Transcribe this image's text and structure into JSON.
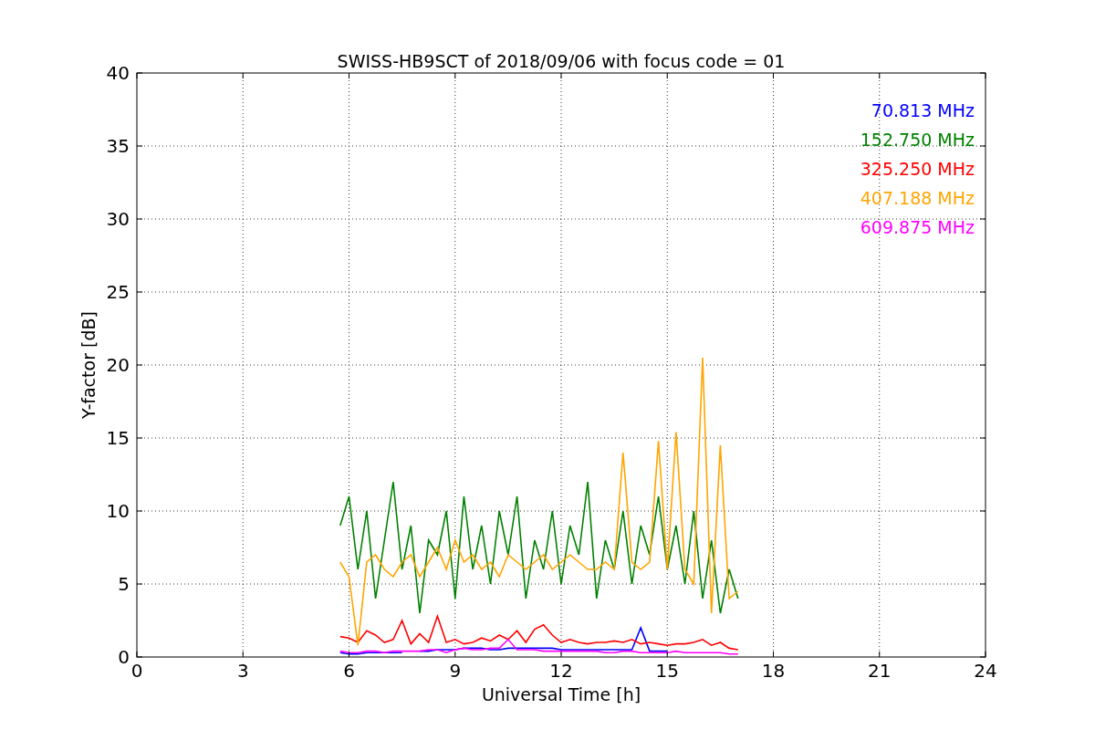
{
  "chart_data": {
    "type": "line",
    "title": "SWISS-HB9SCT of 2018/09/06 with focus code = 01",
    "xlabel": "Universal Time [h]",
    "ylabel": "Y-factor [dB]",
    "grid": true,
    "xlim": [
      0,
      24
    ],
    "ylim": [
      0,
      40
    ],
    "xticks": [
      0,
      3,
      6,
      9,
      12,
      15,
      18,
      21,
      24
    ],
    "yticks": [
      0,
      5,
      10,
      15,
      20,
      25,
      30,
      35,
      40
    ],
    "x": [
      5.75,
      6,
      6.25,
      6.5,
      6.75,
      7,
      7.25,
      7.5,
      7.75,
      8,
      8.25,
      8.5,
      8.75,
      9,
      9.25,
      9.5,
      9.75,
      10,
      10.25,
      10.5,
      10.75,
      11,
      11.25,
      11.5,
      11.75,
      12,
      12.25,
      12.5,
      12.75,
      13,
      13.25,
      13.5,
      13.75,
      14,
      14.25,
      14.5,
      14.75,
      15,
      15.25,
      15.5,
      15.75,
      16,
      16.25,
      16.5,
      16.75,
      17
    ],
    "series": [
      {
        "name": "70.813 MHz",
        "color": "#0000ff",
        "values": [
          0.3,
          0.2,
          0.2,
          0.3,
          0.3,
          0.3,
          0.3,
          0.3,
          null,
          0.4,
          0.4,
          0.5,
          0.5,
          0.5,
          0.6,
          0.6,
          0.6,
          0.5,
          0.5,
          0.6,
          0.6,
          0.6,
          0.6,
          0.6,
          0.6,
          0.5,
          0.5,
          0.5,
          0.5,
          0.5,
          0.5,
          0.5,
          0.5,
          0.5,
          2.0,
          0.4,
          0.4,
          0.4,
          null,
          null,
          null,
          null,
          null,
          null,
          null,
          null
        ]
      },
      {
        "name": "152.750 MHz",
        "color": "#008000",
        "values": [
          9,
          11,
          6,
          10,
          4,
          8,
          12,
          6,
          9,
          3,
          8,
          7,
          10,
          4,
          11,
          6,
          9,
          5,
          10,
          7,
          11,
          4,
          8,
          6,
          10,
          5,
          9,
          7,
          12,
          4,
          8,
          6,
          10,
          5,
          9,
          7,
          11,
          6,
          9,
          5,
          10,
          4,
          8,
          3,
          6,
          4
        ]
      },
      {
        "name": "325.250 MHz",
        "color": "#ff0000",
        "values": [
          1.4,
          1.3,
          1.0,
          1.8,
          1.5,
          1.0,
          1.2,
          2.5,
          0.9,
          1.6,
          1.0,
          2.8,
          1.0,
          1.2,
          0.9,
          1.0,
          1.3,
          1.1,
          1.5,
          1.2,
          1.8,
          1.0,
          1.9,
          2.2,
          1.5,
          1.0,
          1.2,
          1.0,
          0.9,
          1.0,
          1.0,
          1.1,
          1.0,
          1.2,
          0.9,
          1.0,
          0.9,
          0.8,
          0.9,
          0.9,
          1.0,
          1.2,
          0.8,
          1.0,
          0.6,
          0.5
        ]
      },
      {
        "name": "407.188 MHz",
        "color": "#ffa500",
        "values": [
          6.5,
          5.5,
          0.8,
          6.5,
          7,
          6,
          5.5,
          6.5,
          7,
          5.5,
          6.5,
          7.5,
          6,
          8,
          6.5,
          7,
          6,
          6.5,
          5.5,
          7,
          6.5,
          6,
          6.5,
          7,
          6,
          6.5,
          7,
          6.5,
          6,
          6,
          6.5,
          6,
          14,
          6.5,
          6,
          6.5,
          14.8,
          6,
          15.4,
          6,
          5,
          20.5,
          3,
          14.5,
          4,
          4.5
        ]
      },
      {
        "name": "609.875 MHz",
        "color": "#ff00ff",
        "values": [
          0.4,
          0.3,
          0.3,
          0.4,
          0.4,
          0.3,
          0.4,
          0.4,
          0.4,
          0.4,
          0.5,
          0.5,
          0.3,
          0.5,
          0.6,
          0.5,
          0.5,
          0.6,
          0.6,
          1.2,
          0.5,
          0.5,
          0.5,
          0.4,
          0.4,
          0.4,
          0.4,
          0.4,
          0.4,
          0.4,
          0.3,
          0.3,
          0.4,
          0.4,
          0.3,
          0.3,
          0.3,
          0.3,
          0.4,
          0.3,
          0.3,
          0.3,
          0.3,
          0.3,
          0.2,
          0.2
        ]
      }
    ]
  }
}
